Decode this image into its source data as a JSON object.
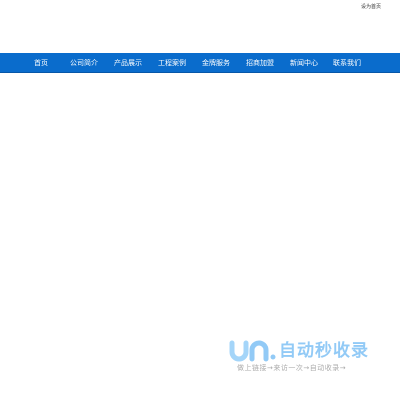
{
  "topbar": {
    "homepage_label": "设为首页"
  },
  "nav": {
    "items": [
      {
        "label": "首页"
      },
      {
        "label": "公司简介"
      },
      {
        "label": "产品展示"
      },
      {
        "label": "工程案例"
      },
      {
        "label": "金牌服务"
      },
      {
        "label": "招商加盟"
      },
      {
        "label": "新闻中心"
      },
      {
        "label": "联系我们"
      }
    ],
    "background_color": "#0a6ccc"
  },
  "watermark": {
    "title": "自动秒收录",
    "subtitle": "做上链接→来访一次→自动收录→"
  }
}
